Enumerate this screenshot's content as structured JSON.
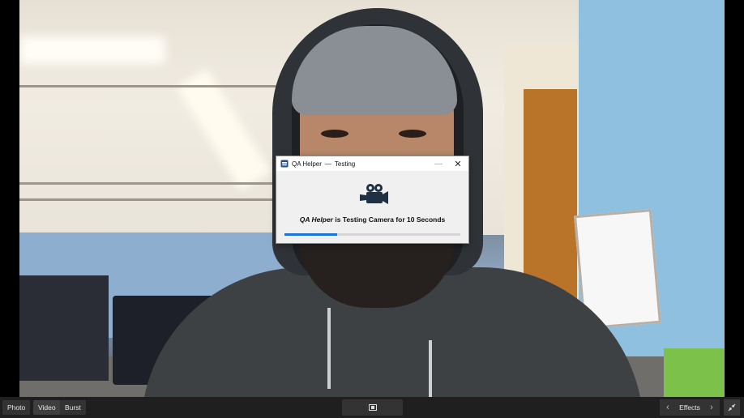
{
  "dialog": {
    "app_name": "QA Helper",
    "separator": "—",
    "window_title": "Testing",
    "minimize_glyph": "—",
    "close_glyph": "✕",
    "icon": "video-camera-icon",
    "message_app": "QA Helper",
    "message_rest": " is Testing Camera for 10 Seconds",
    "progress_fraction": 0.3
  },
  "toolbar": {
    "modes": [
      {
        "label": "Photo",
        "active": false
      },
      {
        "label": "Video",
        "active": true
      },
      {
        "label": "Burst",
        "active": false
      }
    ],
    "effects_label": "Effects",
    "prev_glyph": "‹",
    "next_glyph": "›"
  },
  "colors": {
    "accent": "#1a73d9",
    "toolbar_bg": "#1f1f1f"
  }
}
